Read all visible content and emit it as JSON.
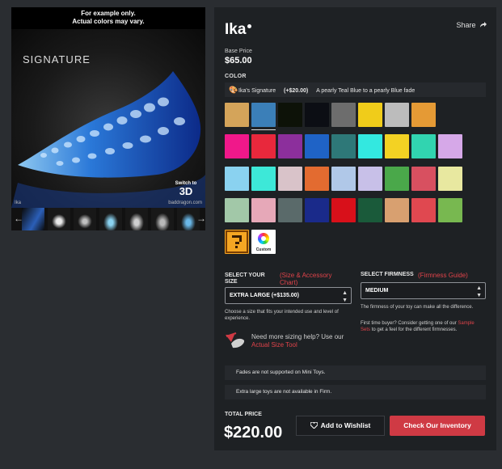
{
  "gallery": {
    "note_line1": "For example only.",
    "note_line2": "Actual colors may vary.",
    "signature_text": "SIGNATURE",
    "image_caption": "Ika",
    "watermark": "baddragon.com",
    "switch_label": "Switch to",
    "switch_3d": "3D",
    "prev_arrow": "←",
    "next_arrow": "→"
  },
  "product": {
    "name": "Ika",
    "share_label": "Share",
    "base_price_label": "Base Price",
    "base_price": "$65.00",
    "color_label": "COLOR"
  },
  "selected_color": {
    "name": "Ika's Signature",
    "upcharge": "(+$20.00)",
    "description": "A pearly Teal Blue to a pearly Blue fade"
  },
  "swatches": [
    [
      "#d4a45a",
      "#3b7fb8",
      "#0d1208",
      "#0c0e14",
      "#6d6d6d",
      "#f0cc1a",
      "#bcbcbc",
      "#e59a35"
    ],
    [
      "#f0188a",
      "#e8283c",
      "#8c2f9c",
      "#1f63c6",
      "#2e7878",
      "#33e8e0",
      "#f3d223",
      "#31d4b0",
      "#d6a8e8"
    ],
    [
      "#8ad2f0",
      "#3de8d8",
      "#d9c3c9",
      "#e36b30",
      "#b0c8e8",
      "#c8c0e8",
      "#4aa84a",
      "#d85060",
      "#e8e8a0"
    ],
    [
      "#a2c8a8",
      "#e6a8b8",
      "#5a6a6a",
      "#1a2a8a",
      "#d8101a",
      "#1a5a3a",
      "#d8a070",
      "#e04850",
      "#78b850"
    ]
  ],
  "special_swatches": {
    "custom_label": "Custom"
  },
  "size": {
    "label": "SELECT YOUR SIZE",
    "link": "(Size & Accessory Chart)",
    "selected": "EXTRA LARGE (+$135.00)",
    "help": "Choose a size that fits your intended use and level of experience."
  },
  "firmness": {
    "label": "SELECT FIRMNESS",
    "link": "(Firmness Guide)",
    "selected": "MEDIUM",
    "help": "The firmness of your toy can make all the difference.",
    "first_timer_pre": "First time buyer? Consider getting one of our",
    "first_timer_link": "Sample Sets",
    "first_timer_post": "to get a feel for the different firmnesses."
  },
  "sizing_help": {
    "text": "Need more sizing help? Use our",
    "link": "Actual Size Tool"
  },
  "notices": [
    "Fades are not supported on Mini Toys.",
    "Extra large toys are not available in Firm."
  ],
  "total": {
    "label": "TOTAL PRICE",
    "value": "$220.00"
  },
  "actions": {
    "wishlist": "Add to Wishlist",
    "inventory": "Check Our Inventory"
  }
}
